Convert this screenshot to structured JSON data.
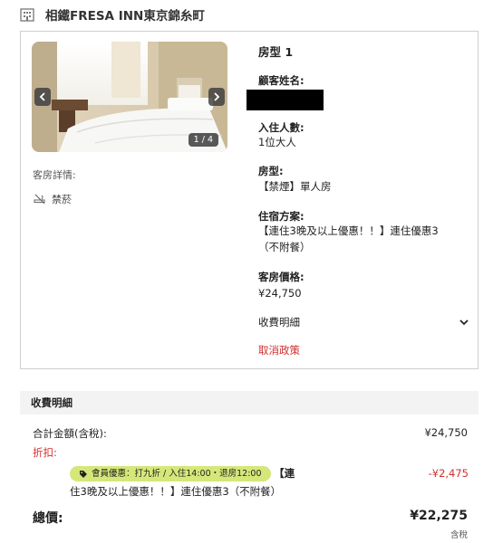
{
  "hotel": {
    "name": "相鐵FRESA INN東京錦糸町",
    "icon": "building-icon"
  },
  "gallery": {
    "counter": "1 / 4",
    "prev_icon": "chevron-left-icon",
    "next_icon": "chevron-right-icon"
  },
  "room_details": {
    "label": "客房詳情:",
    "no_smoking": "禁菸",
    "no_smoking_icon": "no-smoking-icon"
  },
  "room": {
    "title": "房型 1",
    "guest_name_label": "顧客姓名:",
    "occupancy_label": "入住人數:",
    "occupancy_value": "1位大人",
    "type_label": "房型:",
    "type_value": "【禁煙】單人房",
    "plan_label": "住宿方案:",
    "plan_value_line1": "【連住3晚及以上優惠！！】連住優惠3",
    "plan_value_line2": "（不附餐）",
    "price_label": "客房價格:",
    "price_value": "¥24,750",
    "charges_toggle": "收費明細",
    "cancel_policy": "取消政策"
  },
  "charges": {
    "header": "收費明細",
    "subtotal_label": "合計金額(含稅):",
    "subtotal_value": "¥24,750",
    "discount_label": "折扣:",
    "promo_badge": "會員優惠：打九折 / 入住14:00・退房12:00",
    "promo_text_1": "【連",
    "promo_text_2": "住3晚及以上優惠！！】連住優惠3（不附餐）",
    "discount_value": "-¥2,475",
    "total_label": "總價:",
    "total_value": "¥22,275",
    "tax_note": "含稅"
  },
  "colors": {
    "accent_red": "#d32f2f",
    "badge_green": "#d6e77a",
    "border": "#cfcfcf",
    "header_bg": "#f3f3f3"
  }
}
